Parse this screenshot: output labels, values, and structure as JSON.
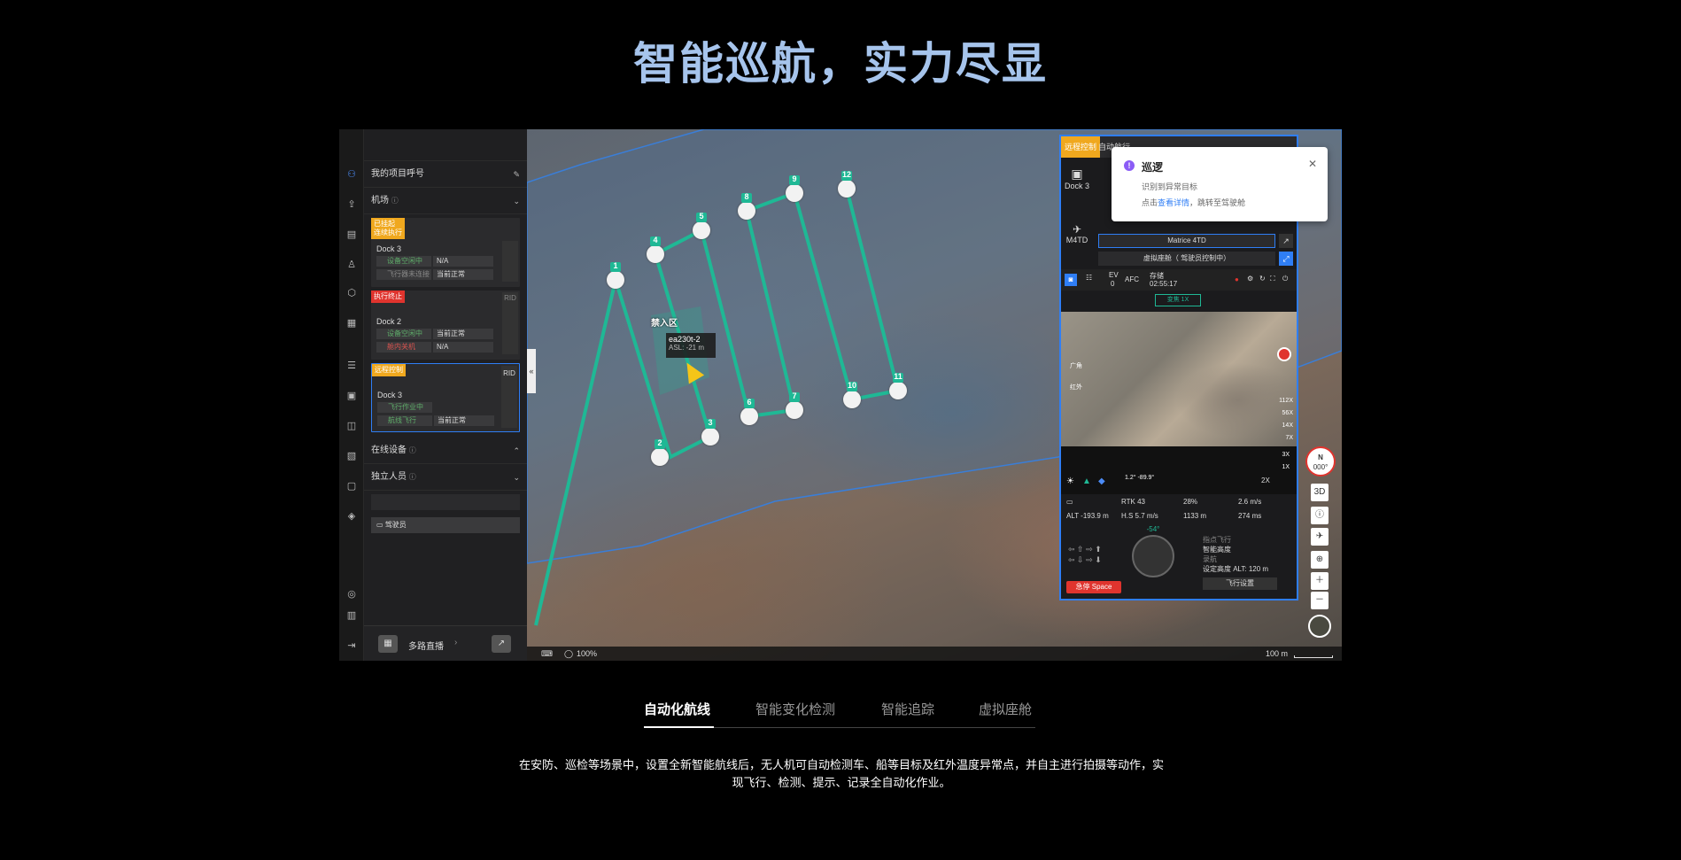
{
  "hero": {
    "title": "智能巡航，实力尽显"
  },
  "sidebar": {
    "project_call": "我的项目呼号",
    "airport_section": "机场",
    "docks": [
      {
        "badge": "已挂起 连续执行",
        "badge_color": "#f0a81e",
        "name": "Dock 3",
        "rows": [
          {
            "k": "设备空闲中",
            "v": "N/A"
          },
          {
            "k": "飞行器未连接",
            "v": "当前正常"
          }
        ]
      },
      {
        "badge": "执行终止",
        "badge_color": "#e0342e",
        "name": "Dock 2",
        "rows": [
          {
            "k": "设备空闲中",
            "v": "当前正常"
          },
          {
            "k": "舱内关机",
            "v": "N/A"
          }
        ],
        "side": "RID"
      },
      {
        "badge": "远程控制",
        "badge_color": "#f0a81e",
        "name": "Dock 3",
        "rows": [
          {
            "k": "飞行作业中",
            "v": ""
          },
          {
            "k": "航线飞行",
            "v": "当前正常"
          }
        ],
        "side": "RID"
      }
    ],
    "online_devices": "在线设备",
    "independent_personnel": "独立人员",
    "pilot_label": "驾驶员",
    "multi_stream": "多路直播"
  },
  "map": {
    "zone_label": "禁入区",
    "drone_id": "ea230t-2",
    "drone_asl": "ASL: -21 m",
    "zoom_pct": "100%",
    "scale": "100 m",
    "waypoints": [
      "1",
      "2",
      "3",
      "4",
      "5",
      "6",
      "7",
      "8",
      "9",
      "10",
      "11",
      "12"
    ]
  },
  "control": {
    "tab_remote": "远程控制",
    "tab_auto": "自动航行",
    "dock_label": "Dock 3",
    "drone_label": "M4TD",
    "model": "Matrice 4TD",
    "virtual_cockpit": "虚拟座舱（ 驾驶员控制中）",
    "ev": "EV",
    "ev_val": "0",
    "afc": "AFC",
    "storage": "存储",
    "rec_time": "02:55:17",
    "zoom_btn": "变焦 1X",
    "wide": "广角",
    "ir": "红外",
    "zoom_levels": [
      "112X",
      "56X",
      "14X",
      "7X",
      "3X",
      "1X"
    ],
    "zoom_current": "2X",
    "gimbal": "1.2° -89.9°",
    "rtk": "RTK",
    "rtk_sats": "43",
    "battery": "28%",
    "speed": "2.6 m/s",
    "alt": "ALT -193.9 m",
    "hs": "H.S 5.7 m/s",
    "dist": "1133 m",
    "height": "274 ms",
    "heading": "-54°",
    "mode1": "指点飞行",
    "mode2": "智能高度",
    "mode3": "录航",
    "set_alt": "设定高度 ALT: 120 m",
    "stop": "急停 Space",
    "flight_settings": "飞行设置"
  },
  "toast": {
    "title": "巡逻",
    "line1": "识别到异常目标",
    "line2_prefix": "点击",
    "line2_link": "查看详情",
    "line2_suffix": "，跳转至驾驶舱"
  },
  "compass": {
    "dir": "N",
    "deg": "000°"
  },
  "map_tools": [
    "3D"
  ],
  "feature_tabs": [
    "自动化航线",
    "智能变化检测",
    "智能追踪",
    "虚拟座舱"
  ],
  "description": "在安防、巡检等场景中，设置全新智能航线后，无人机可自动检测车、船等目标及红外温度异常点，并自主进行拍摄等动作，实现飞行、检测、提示、记录全自动化作业。",
  "colors": {
    "accent": "#2f7ef5",
    "route": "#1fb895",
    "warning": "#f0a81e",
    "danger": "#e0342e"
  }
}
